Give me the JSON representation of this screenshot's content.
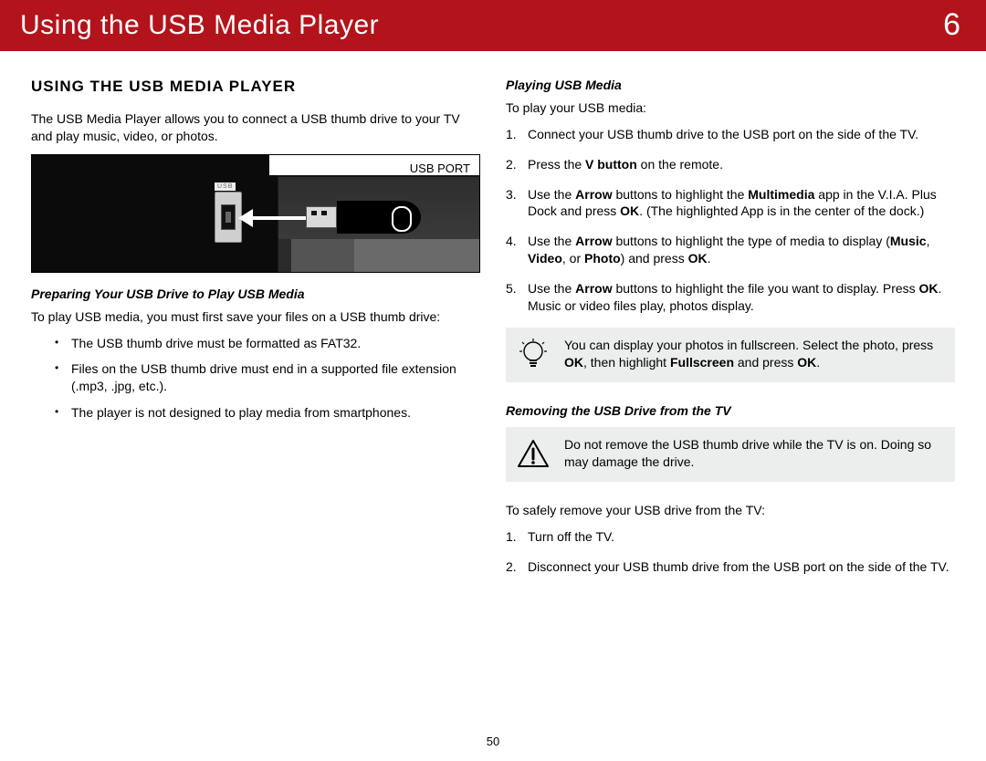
{
  "banner": {
    "title": "Using the USB Media Player",
    "chapter": "6"
  },
  "left": {
    "heading": "USING THE USB MEDIA PLAYER",
    "intro": "The USB Media Player allows you to connect a USB thumb drive to your TV and play music, video, or photos.",
    "figure": {
      "caption": "USB PORT",
      "socketLabel": "USB"
    },
    "sub1": "Preparing Your USB Drive to Play USB Media",
    "sub1_intro": "To play USB media, you must first save your files on a USB thumb drive:",
    "bullets": [
      "The USB thumb drive must be formatted as FAT32.",
      "Files on the USB thumb drive must end in a supported file extension (.mp3, .jpg, etc.).",
      "The player is not designed to play media from smartphones."
    ]
  },
  "right": {
    "sub2": "Playing USB Media",
    "sub2_intro": "To play your USB media:",
    "steps": [
      "Connect your USB thumb drive to the USB port on the side of the TV.",
      "Press the <strong class='b'>V button</strong> on the remote.",
      "Use the <strong class='b'>Arrow</strong> buttons to highlight the <strong class='b'>Multimedia</strong> app in the V.I.A. Plus Dock and press <strong class='b'>OK</strong>. (The highlighted App is in the center of the dock.)",
      "Use the <strong class='b'>Arrow</strong> buttons to highlight the type of media to display (<strong class='b'>Music</strong>, <strong class='b'>Video</strong>, or <strong class='b'>Photo</strong>) and press <strong class='b'>OK</strong>.",
      "Use the <strong class='b'>Arrow</strong> buttons to highlight the file you want to display. Press <strong class='b'>OK</strong>. Music or video files play, photos display."
    ],
    "tip": "You can display your photos in fullscreen. Select the photo, press <strong class='b'>OK</strong>, then highlight <strong class='b'>Fullscreen</strong> and press <strong class='b'>OK</strong>.",
    "sub3": "Removing the USB Drive from the TV",
    "warn": "Do not remove the USB thumb drive while the TV is on. Doing so may damage the drive.",
    "sub3_intro": "To safely remove your USB drive from the TV:",
    "steps2": [
      "Turn off the TV.",
      "Disconnect your USB thumb drive from the USB port on the side of the TV."
    ]
  },
  "pageNumber": "50"
}
